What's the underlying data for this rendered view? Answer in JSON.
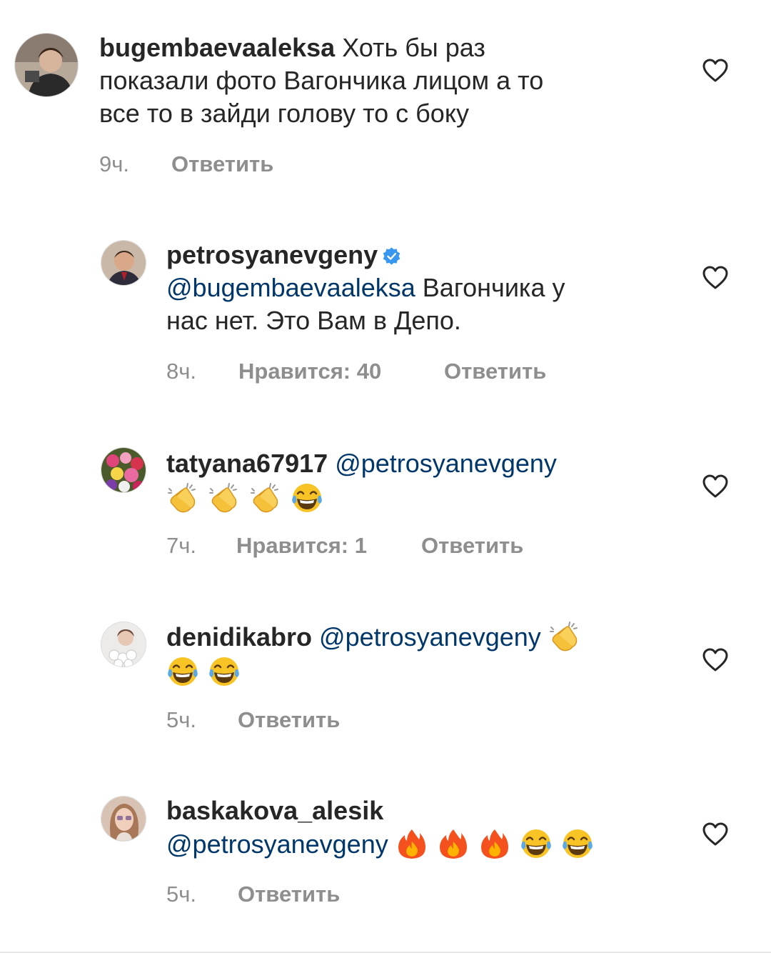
{
  "comments": [
    {
      "username": "bugembaevaaleksa",
      "text_line1": " Хоть бы раз",
      "text_line2": "показали фото Вагончика лицом а то",
      "text_line3": "все  то в зайди голову то с боку",
      "time": "9ч.",
      "reply": "Ответить"
    },
    {
      "username": "petrosyanevgeny",
      "verified": true,
      "mention": "@bugembaevaaleksa",
      "text_line1": " Вагончика у",
      "text_line2": "нас нет. Это Вам в Депо.",
      "time": "8ч.",
      "likes": "Нравится: 40",
      "reply": "Ответить"
    },
    {
      "username": "tatyana67917",
      "mention": "@petrosyanevgeny",
      "emojis": [
        "clapping-hands",
        "clapping-hands",
        "clapping-hands",
        "tears-of-joy"
      ],
      "time": "7ч.",
      "likes": "Нравится: 1",
      "reply": "Ответить"
    },
    {
      "username": "denidikabro",
      "mention": "@petrosyanevgeny",
      "emojis": [
        "clapping-hands",
        "tears-of-joy",
        "tears-of-joy"
      ],
      "time": "5ч.",
      "reply": "Ответить"
    },
    {
      "username": "baskakova_alesik",
      "mention": "@petrosyanevgeny",
      "emojis": [
        "fire",
        "fire",
        "fire",
        "tears-of-joy",
        "tears-of-joy"
      ],
      "time": "5ч.",
      "reply": "Ответить"
    }
  ],
  "colors": {
    "text": "#262626",
    "secondary": "#8e8e8e",
    "mention": "#00376b",
    "verified": "#3897f0"
  }
}
